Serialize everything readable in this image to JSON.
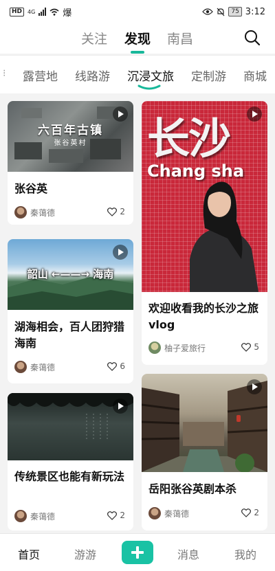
{
  "status": {
    "hd": "HD",
    "net": "4G",
    "carrier_icon": "爆",
    "battery": "75",
    "time": "3:12"
  },
  "top_tabs": [
    "关注",
    "发现",
    "南昌"
  ],
  "category_tabs": [
    "露营地",
    "线路游",
    "沉浸文旅",
    "定制游",
    "商城"
  ],
  "colors": {
    "accent": "#18b89a",
    "plus": "#19c2a4"
  },
  "cards": [
    {
      "title": "张谷英",
      "author": "秦蔼德",
      "likes": "2",
      "thumb_title": "六百年古镇",
      "thumb_sub": "张谷英村"
    },
    {
      "title": "欢迎收看我的长沙之旅vlog",
      "author": "柚子爱旅行",
      "likes": "5",
      "thumb_title": "长沙",
      "thumb_sub": "Chang sha"
    },
    {
      "title": "湖海相会，百人团狩猎海南",
      "author": "秦蔼德",
      "likes": "6",
      "thumb_title": "韶山 ←——→ 海南"
    },
    {
      "title": "传统景区也能有新玩法",
      "author": "秦蔼德",
      "likes": "2"
    },
    {
      "title": "岳阳张谷英剧本杀",
      "author": "秦蔼德",
      "likes": "2"
    }
  ],
  "bottom_nav": [
    "首页",
    "游游",
    "消息",
    "我的"
  ]
}
